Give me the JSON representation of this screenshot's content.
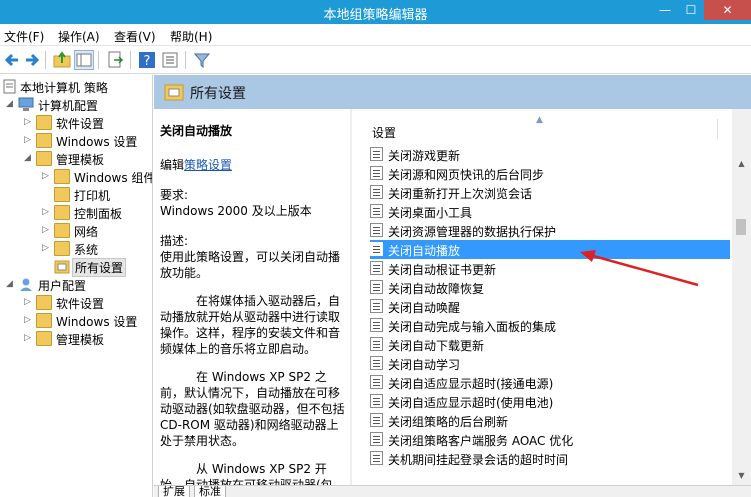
{
  "window": {
    "title": "本地组策略编辑器",
    "min": "—",
    "max": "☐",
    "close": "✕"
  },
  "menu": [
    "文件(F)",
    "操作(A)",
    "查看(V)",
    "帮助(H)"
  ],
  "tree": {
    "root": "本地计算机 策略",
    "computer": "计算机配置",
    "c_software": "软件设置",
    "c_windows": "Windows 设置",
    "c_admin": "管理模板",
    "a_windows": "Windows 组件",
    "a_printer": "打印机",
    "a_control": "控制面板",
    "a_network": "网络",
    "a_system": "系统",
    "a_all": "所有设置",
    "user": "用户配置",
    "u_software": "软件设置",
    "u_windows": "Windows 设置",
    "u_admin": "管理模板"
  },
  "header": {
    "title": "所有设置"
  },
  "desc": {
    "title": "关闭自动播放",
    "edit_prefix": "编辑",
    "edit_link": "策略设置",
    "req_label": "要求:",
    "req_value": "Windows 2000 及以上版本",
    "desc_label": "描述:",
    "desc_text": "使用此策略设置，可以关闭自动播放功能。",
    "para1": "在将媒体插入驱动器后，自动播放就开始从驱动器中进行读取操作。这样，程序的安装文件和音频媒体上的音乐将立即启动。",
    "para2": "在 Windows XP SP2 之前，默认情况下，自动播放在可移动驱动器(如软盘驱动器，但不包括 CD-ROM 驱动器)和网络驱动器上处于禁用状态。",
    "para3": "从 Windows XP SP2 开始，自动播放在可移动驱动器(包"
  },
  "list": {
    "column": "设置",
    "selected_index": 5,
    "items": [
      "关闭游戏更新",
      "关闭源和网页快讯的后台同步",
      "关闭重新打开上次浏览会话",
      "关闭桌面小工具",
      "关闭资源管理器的数据执行保护",
      "关闭自动播放",
      "关闭自动根证书更新",
      "关闭自动故障恢复",
      "关闭自动唤醒",
      "关闭自动完成与输入面板的集成",
      "关闭自动下载更新",
      "关闭自动学习",
      "关闭自适应显示超时(接通电源)",
      "关闭自适应显示超时(使用电池)",
      "关闭组策略的后台刷新",
      "关闭组策略客户端服务 AOAC 优化",
      "关机期间挂起登录会话的超时时间"
    ]
  },
  "tabs": {
    "extended": "扩展",
    "standard": "标准"
  },
  "colors": {
    "titlebar": "#1e9bd7",
    "header_band": "#aac7e4",
    "selection": "#3399ff",
    "arrow": "#e02020"
  }
}
